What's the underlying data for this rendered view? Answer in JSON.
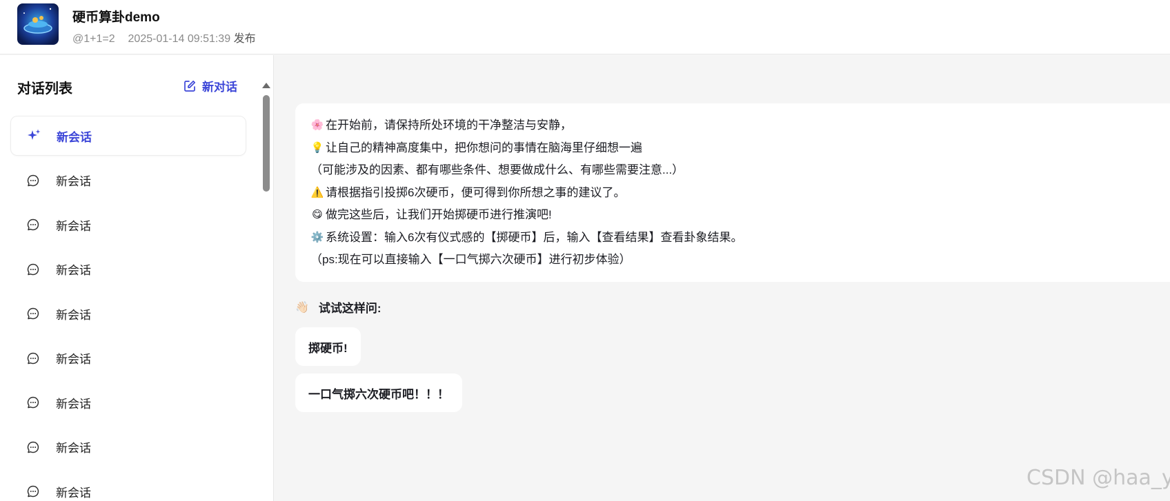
{
  "header": {
    "title": "硬币算卦demo",
    "author": "@1+1=2",
    "date": "2025-01-14 09:51:39",
    "publish_label": "发布"
  },
  "sidebar": {
    "title": "对话列表",
    "new_chat_label": "新对话",
    "items": [
      {
        "label": "新会话",
        "icon": "sparkle-icon",
        "active": true
      },
      {
        "label": "新会话",
        "icon": "chat-bubble-icon"
      },
      {
        "label": "新会话",
        "icon": "chat-bubble-icon"
      },
      {
        "label": "新会话",
        "icon": "chat-bubble-icon"
      },
      {
        "label": "新会话",
        "icon": "chat-bubble-icon"
      },
      {
        "label": "新会话",
        "icon": "chat-bubble-icon"
      },
      {
        "label": "新会话",
        "icon": "chat-bubble-icon"
      },
      {
        "label": "新会话",
        "icon": "chat-bubble-icon"
      },
      {
        "label": "新会话",
        "icon": "chat-bubble-icon"
      }
    ]
  },
  "welcome": {
    "lines": [
      {
        "emoji": "🌸",
        "text": "在开始前，请保持所处环境的干净整洁与安静，"
      },
      {
        "emoji": "💡",
        "text": "让自己的精神高度集中，把你想问的事情在脑海里仔细想一遍"
      },
      {
        "emoji": "",
        "text": "（可能涉及的因素、都有哪些条件、想要做成什么、有哪些需要注意...）"
      },
      {
        "emoji": "⚠️",
        "text": "请根据指引投掷6次硬币，便可得到你所想之事的建议了。"
      },
      {
        "emoji": "😋",
        "text": "做完这些后，让我们开始掷硬币进行推演吧!"
      },
      {
        "emoji": "⚙️",
        "text": "系统设置：输入6次有仪式感的【掷硬币】后，输入【查看结果】查看卦象结果。"
      },
      {
        "emoji": "",
        "text": "（ps:现在可以直接输入【一口气掷六次硬币】进行初步体验）"
      }
    ]
  },
  "suggestions": {
    "title": "试试这样问:",
    "items": [
      "掷硬币!",
      "一口气掷六次硬币吧！！！"
    ]
  },
  "watermark": "CSDN @haa_y",
  "colors": {
    "accent": "#3c46d8",
    "background": "#f5f5f5"
  }
}
